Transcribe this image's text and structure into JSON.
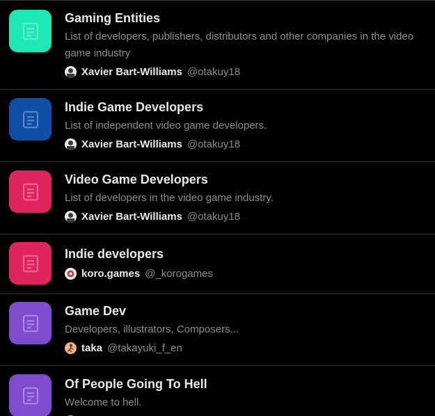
{
  "lists": [
    {
      "name": "Gaming Entities",
      "description": "List of developers, publishers, distributors and other companies in the video game industry",
      "owner_name": "Xavier Bart-Williams",
      "owner_handle": "@otakuy18",
      "thumb_color": "#1de9b6",
      "icon": "list-icon"
    },
    {
      "name": "Indie Game Developers",
      "description": "List of independent video game developers.",
      "owner_name": "Xavier Bart-Williams",
      "owner_handle": "@otakuy18",
      "thumb_color": "#0d4ea6",
      "icon": "list-icon"
    },
    {
      "name": "Video Game Developers",
      "description": "List of developers in the video game industry.",
      "owner_name": "Xavier Bart-Williams",
      "owner_handle": "@otakuy18",
      "thumb_color": "#e0245e",
      "icon": "list-icon"
    },
    {
      "name": "Indie developers",
      "description": "",
      "owner_name": "koro.games",
      "owner_handle": "@_korogames",
      "thumb_color": "#e0245e",
      "icon": "list-icon"
    },
    {
      "name": "Game Dev",
      "description": "Developers, illustrators, Composers...",
      "owner_name": "taka",
      "owner_handle": "@takayuki_f_en",
      "thumb_color": "#7f4ccf",
      "icon": "list-icon"
    },
    {
      "name": "Of People Going To Hell",
      "description": "Welcome to hell.",
      "owner_name": "",
      "owner_handle": "",
      "thumb_color": "#7f4ccf",
      "icon": "list-icon"
    }
  ]
}
